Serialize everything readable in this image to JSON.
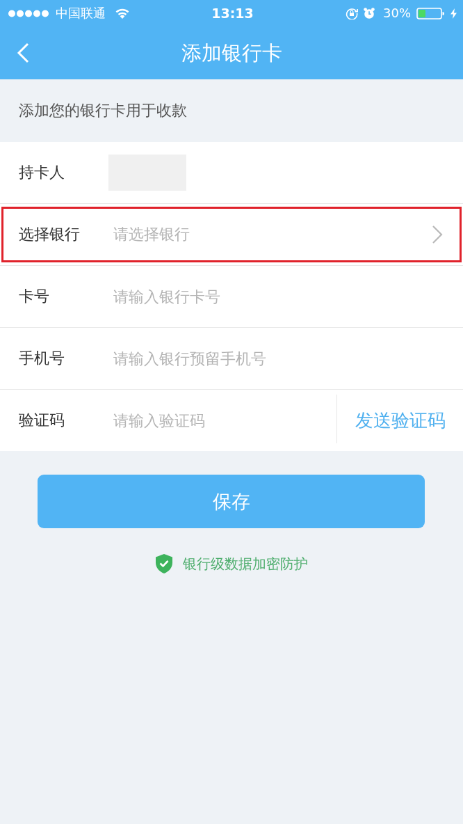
{
  "status_bar": {
    "carrier": "中国联通",
    "time": "13:13",
    "battery": "30%"
  },
  "nav": {
    "title": "添加银行卡"
  },
  "intro": "添加您的银行卡用于收款",
  "form": {
    "rows": [
      {
        "kind": "redacted",
        "label": "持卡人",
        "highlighted": false
      },
      {
        "kind": "select",
        "label": "选择银行",
        "placeholder": "请选择银行",
        "highlighted": true
      },
      {
        "kind": "input",
        "label": "卡号",
        "placeholder": "请输入银行卡号",
        "highlighted": false
      },
      {
        "kind": "input",
        "label": "手机号",
        "placeholder": "请输入银行预留手机号",
        "highlighted": false
      },
      {
        "kind": "code",
        "label": "验证码",
        "placeholder": "请输入验证码",
        "action": "发送验证码",
        "highlighted": false
      }
    ]
  },
  "save_button": {
    "label": "保存"
  },
  "security_note": "银行级数据加密防护"
}
